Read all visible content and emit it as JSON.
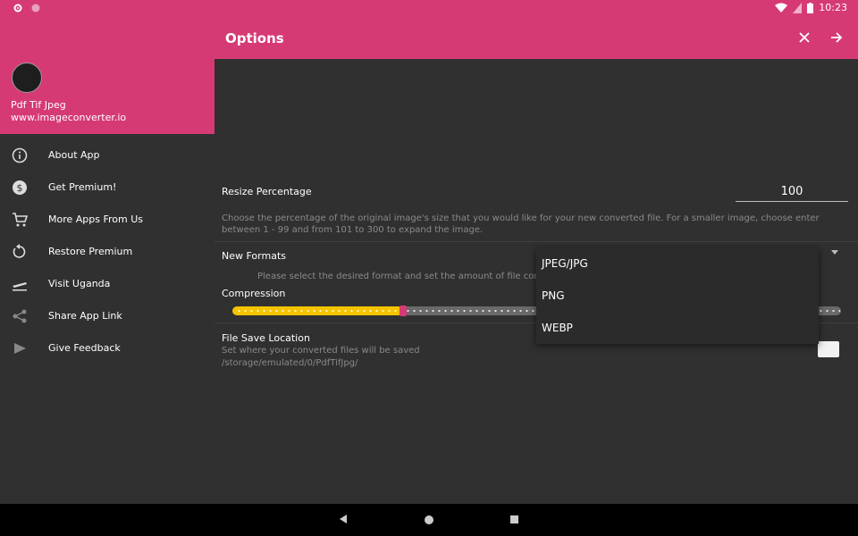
{
  "status": {
    "time": "10:23"
  },
  "drawer": {
    "app_name": "Pdf Tif Jpeg",
    "site": "www.imageconverter.io",
    "items": [
      {
        "label": "About App",
        "icon": "info-icon"
      },
      {
        "label": "Get Premium!",
        "icon": "dollar-icon"
      },
      {
        "label": "More Apps From Us",
        "icon": "cart-icon"
      },
      {
        "label": "Restore Premium",
        "icon": "restore-icon"
      },
      {
        "label": "Visit Uganda",
        "icon": "plane-icon"
      },
      {
        "label": "Share App Link",
        "icon": "share-icon"
      },
      {
        "label": "Give Feedback",
        "icon": "send-icon"
      }
    ]
  },
  "appbar": {
    "title": "Options"
  },
  "options": {
    "resize_label": "Resize Percentage",
    "resize_value": "100",
    "resize_help": "Choose the percentage of the original image's size that you would like for your new converted file. For a smaller image, choose enter between 1 - 99 and from 101 to 300 to expand the image.",
    "formats_label": "New Formats",
    "formats_help": "Please select the desired format and set the amount of file compre",
    "compression_label": "Compression",
    "compression_fraction": 0.28,
    "save_label": "File Save Location",
    "save_help": "Set where your converted files will be saved",
    "save_path": "/storage/emulated/0/PdfTifJpg/"
  },
  "format_menu": {
    "options": [
      "JPEG/JPG",
      "PNG",
      "WEBP"
    ]
  },
  "colors": {
    "primary": "#d63a74",
    "accent": "#f5c400",
    "background": "#303030"
  }
}
